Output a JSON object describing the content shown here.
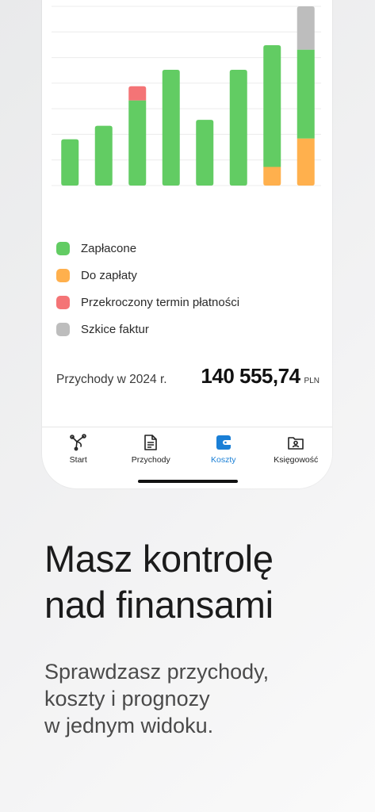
{
  "chart_data": {
    "type": "bar",
    "stacked": true,
    "categories": [
      "",
      "",
      "",
      "",
      "",
      "",
      "",
      ""
    ],
    "ylim": [
      0,
      240
    ],
    "grid": true,
    "series": [
      {
        "name": "Do zapłaty",
        "color": "#ffb04d",
        "values": [
          0,
          0,
          0,
          0,
          0,
          0,
          25,
          63
        ]
      },
      {
        "name": "Zapłacone",
        "color": "#62cc63",
        "values": [
          62,
          80,
          114,
          155,
          88,
          155,
          163,
          119
        ]
      },
      {
        "name": "Przekroczony termin płatności",
        "color": "#f47476",
        "values": [
          0,
          0,
          19,
          0,
          0,
          0,
          0,
          0
        ]
      },
      {
        "name": "Szkice faktur",
        "color": "#bdbdbd",
        "values": [
          0,
          0,
          0,
          0,
          0,
          0,
          0,
          58
        ]
      }
    ]
  },
  "legend": [
    {
      "label": "Zapłacone",
      "color": "#62cc63"
    },
    {
      "label": "Do zapłaty",
      "color": "#ffb04d"
    },
    {
      "label": "Przekroczony termin płatności",
      "color": "#f47476"
    },
    {
      "label": "Szkice faktur",
      "color": "#bdbdbd"
    }
  ],
  "summary": {
    "label": "Przychody w 2024 r.",
    "amount": "140 555,74",
    "currency": "PLN"
  },
  "tabs": [
    {
      "label": "Start",
      "icon": "start-icon",
      "active": false
    },
    {
      "label": "Przychody",
      "icon": "document-icon",
      "active": false
    },
    {
      "label": "Koszty",
      "icon": "wallet-icon",
      "active": true
    },
    {
      "label": "Księgowość",
      "icon": "folder-user-icon",
      "active": false
    }
  ],
  "colors": {
    "accent": "#1a7fd6"
  },
  "headline": {
    "line1": "Masz kontrolę",
    "line2": "nad finansami"
  },
  "subtext": {
    "line1": "Sprawdzasz przychody,",
    "line2": "koszty i prognozy",
    "line3": "w jednym widoku."
  }
}
